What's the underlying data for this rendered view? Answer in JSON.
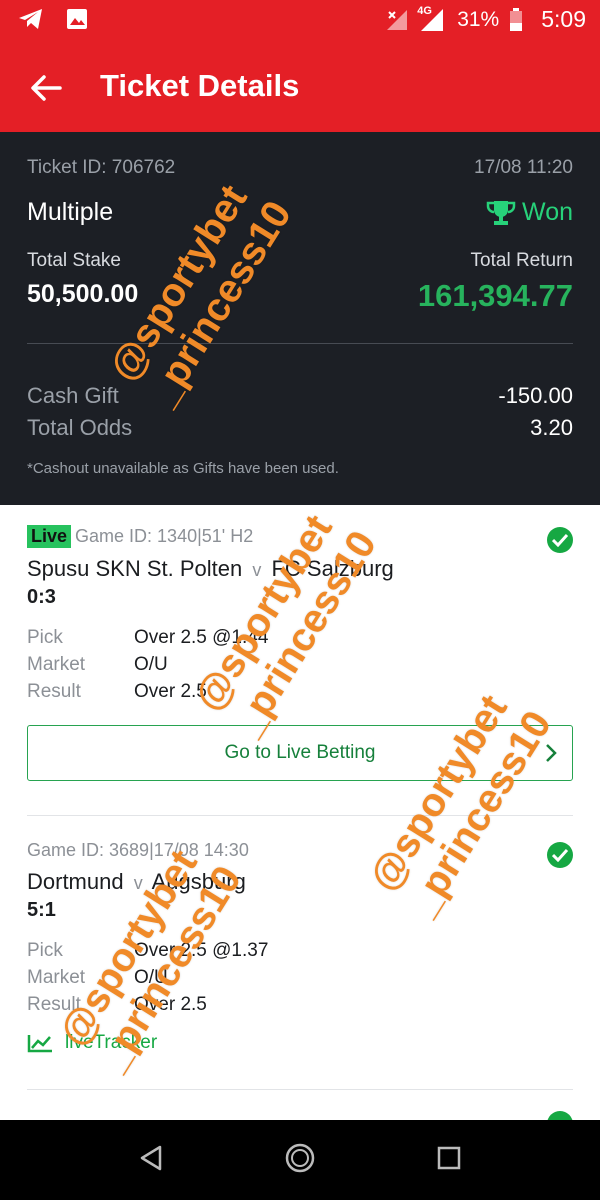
{
  "status_bar": {
    "icons_left": [
      "telegram-icon",
      "image-icon"
    ],
    "icons_right": [
      "no-signal-icon",
      "4g-signal-icon",
      "battery-icon"
    ],
    "network": "4G",
    "battery": "31%",
    "time": "5:09"
  },
  "header": {
    "title": "Ticket Details",
    "back_icon": "arrow-left-icon",
    "background_color": "#e41f26"
  },
  "ticket": {
    "id_label": "Ticket ID: 706762",
    "datetime": "17/08 11:20",
    "type": "Multiple",
    "status": "Won",
    "status_color": "#27d27a",
    "total_stake_label": "Total Stake",
    "total_stake": "50,500.00",
    "total_return_label": "Total Return",
    "total_return": "161,394.77",
    "cash_gift_label": "Cash Gift",
    "cash_gift": "-150.00",
    "total_odds_label": "Total Odds",
    "total_odds": "3.20",
    "note": "*Cashout unavailable as Gifts have been used."
  },
  "selections": [
    {
      "live_badge": "Live",
      "game_info": "Game ID: 1340|51' H2",
      "home": "Spusu SKN St. Polten",
      "vs": "v",
      "away": "FC Salzburg",
      "score": "0:3",
      "pick_label": "Pick",
      "pick": "Over 2.5 @1.44",
      "market_label": "Market",
      "market": "O/U",
      "result_label": "Result",
      "result": "Over 2.5",
      "action_label": "Go to Live Betting"
    },
    {
      "game_info": "Game ID: 3689|17/08 14:30",
      "home": "Dortmund",
      "vs": "v",
      "away": "Augsburg",
      "score": "5:1",
      "pick_label": "Pick",
      "pick": "Over 2.5 @1.37",
      "market_label": "Market",
      "market": "O/U",
      "result_label": "Result",
      "result": "Over 2.5",
      "tracker_label": "liveTracker"
    }
  ],
  "watermark": {
    "line1": "@sportybet",
    "line2": "_princess10"
  },
  "nav_bar": {
    "buttons": [
      "back-triangle-icon",
      "home-circle-icon",
      "recents-square-icon"
    ]
  }
}
